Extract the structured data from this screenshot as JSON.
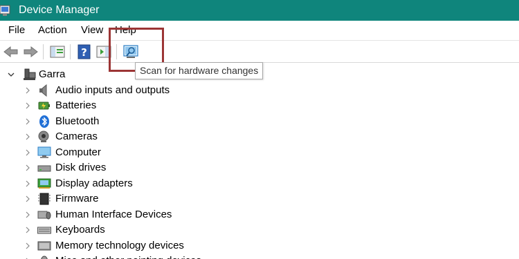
{
  "window": {
    "title": "Device Manager"
  },
  "menu": [
    "File",
    "Action",
    "View",
    "Help"
  ],
  "toolbar": {
    "buttons": [
      "back-icon",
      "forward-icon",
      "show-hide-console-tree-icon",
      "help-icon",
      "properties-pane-icon",
      "scan-hardware-icon"
    ]
  },
  "tooltip": {
    "text": "Scan for hardware changes"
  },
  "tree": {
    "root": {
      "label": "Garra",
      "icon": "computer-icon"
    },
    "categories": [
      {
        "label": "Audio inputs and outputs",
        "icon": "speaker-icon"
      },
      {
        "label": "Batteries",
        "icon": "battery-icon"
      },
      {
        "label": "Bluetooth",
        "icon": "bluetooth-icon"
      },
      {
        "label": "Cameras",
        "icon": "camera-icon"
      },
      {
        "label": "Computer",
        "icon": "monitor-icon"
      },
      {
        "label": "Disk drives",
        "icon": "disk-drive-icon"
      },
      {
        "label": "Display adapters",
        "icon": "display-adapter-icon"
      },
      {
        "label": "Firmware",
        "icon": "firmware-chip-icon"
      },
      {
        "label": "Human Interface Devices",
        "icon": "hid-icon"
      },
      {
        "label": "Keyboards",
        "icon": "keyboard-icon"
      },
      {
        "label": "Memory technology devices",
        "icon": "memory-icon"
      },
      {
        "label": "Mice and other pointing devices",
        "icon": "mouse-icon"
      }
    ]
  },
  "colors": {
    "titlebar": "#0f857c",
    "highlight": "#9c3535"
  }
}
